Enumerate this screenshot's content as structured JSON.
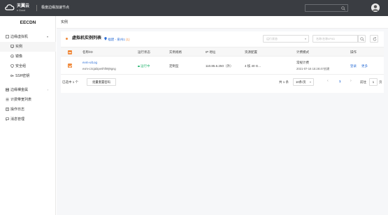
{
  "topbar": {
    "logo_text": "天翼云",
    "logo_sub": "e Cloud",
    "app_title": "极度边缘加速节点"
  },
  "sidebar": {
    "brand": "EECDN",
    "items": [
      {
        "label": "边缘虚拟机",
        "icon": "cube-icon",
        "has_children": true,
        "level": 0
      },
      {
        "label": "实例",
        "icon": "monitor-icon",
        "level": 1,
        "active": true
      },
      {
        "label": "镜像",
        "icon": "disc-icon",
        "level": 1
      },
      {
        "label": "安全组",
        "icon": "shield-icon",
        "level": 1
      },
      {
        "label": "SSH密钥",
        "icon": "key-icon",
        "level": 1
      },
      {
        "label": "边缘裸金属",
        "icon": "server-icon",
        "has_children": true,
        "level": 0
      },
      {
        "label": "计费带宽列表",
        "icon": "list-icon",
        "level": 0
      },
      {
        "label": "操作日志",
        "icon": "log-icon",
        "level": 0
      },
      {
        "label": "消息管理",
        "icon": "message-icon",
        "level": 0
      }
    ]
  },
  "breadcrumb": "实例",
  "card": {
    "title": "虚拟机实例列表",
    "region": "福建 - 泉州1",
    "region_count": "(1)",
    "status_filter_placeholder": "运行状态",
    "search_placeholder": "名称/名称/IP/ID"
  },
  "table": {
    "headers": [
      "名称/ID",
      "运行状态",
      "实例规格",
      "IP 地址",
      "资源配置",
      "计费模式",
      "操作"
    ],
    "rows": [
      {
        "name": "evm-ul1og",
        "id": "evm-c3cjabipe0hf09j9gng",
        "status": "运行中",
        "spec": "定制型",
        "ip": "110.85.6.250（外）",
        "config": "4 核 40 G...",
        "billing_mode": "常规计费",
        "billing_time": "2021-07-16 15:28:47创建",
        "actions": [
          "登录",
          "更多"
        ]
      }
    ]
  },
  "footer": {
    "selected_text": "已选中 1 个",
    "batch_button": "批量重置密码",
    "total": "共 1 条",
    "page_size": "10条/页",
    "current_page": "1",
    "goto_label": "前往",
    "goto_value": "1",
    "goto_suffix": "页"
  },
  "colors": {
    "accent": "#f08a3c",
    "link": "#2d6fd6",
    "running": "#2bb673",
    "topbar": "#3a3d42"
  }
}
